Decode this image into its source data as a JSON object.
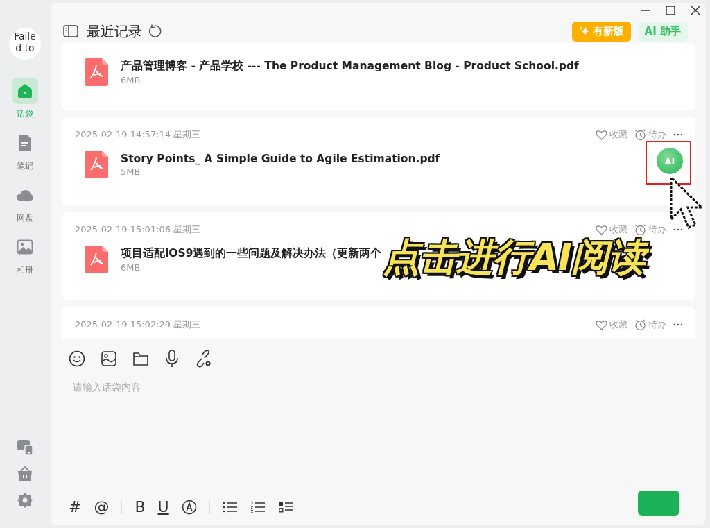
{
  "sidebar": {
    "avatar_text": "Failed to",
    "items": [
      {
        "kind": "bag",
        "label": "话袋",
        "selected": true
      },
      {
        "kind": "note",
        "label": "笔记",
        "selected": false
      },
      {
        "kind": "cloud",
        "label": "网盘",
        "selected": false
      },
      {
        "kind": "photo",
        "label": "相册",
        "selected": false
      }
    ]
  },
  "header": {
    "title": "最近记录",
    "buttons": [
      {
        "kind": "update",
        "label": "有新版"
      },
      {
        "kind": "assistant",
        "label": "AI 助手"
      }
    ]
  },
  "records": [
    {
      "file_name": "产品管理博客 - 产品学校 --- The Product Management Blog - Product School.pdf",
      "size": "6MB"
    },
    {
      "date": "2025-02-19 14:57:14 星期三",
      "actions": [
        "收藏",
        "待办"
      ],
      "file_name": "Story Points_ A Simple Guide to Agile Estimation.pdf",
      "size": "5MB",
      "ai_button": {
        "label": "AI",
        "highlighted": true
      }
    },
    {
      "date": "2025-02-19 15:01:06 星期三",
      "actions": [
        "收藏",
        "待办"
      ],
      "file_name": "项目适配iOS9遇到的一些问题及解决办法（更新两个",
      "size": "6MB"
    },
    {
      "date": "2025-02-19 15:02:29 星期三",
      "actions": [
        "收藏",
        "待办"
      ]
    }
  ],
  "composer": {
    "placeholder": "请输入话袋内容",
    "insert_chars": [
      "#",
      "@"
    ],
    "style_chars": [
      "B",
      "U"
    ]
  },
  "annotation": {
    "text": "点击进行AI阅读"
  }
}
